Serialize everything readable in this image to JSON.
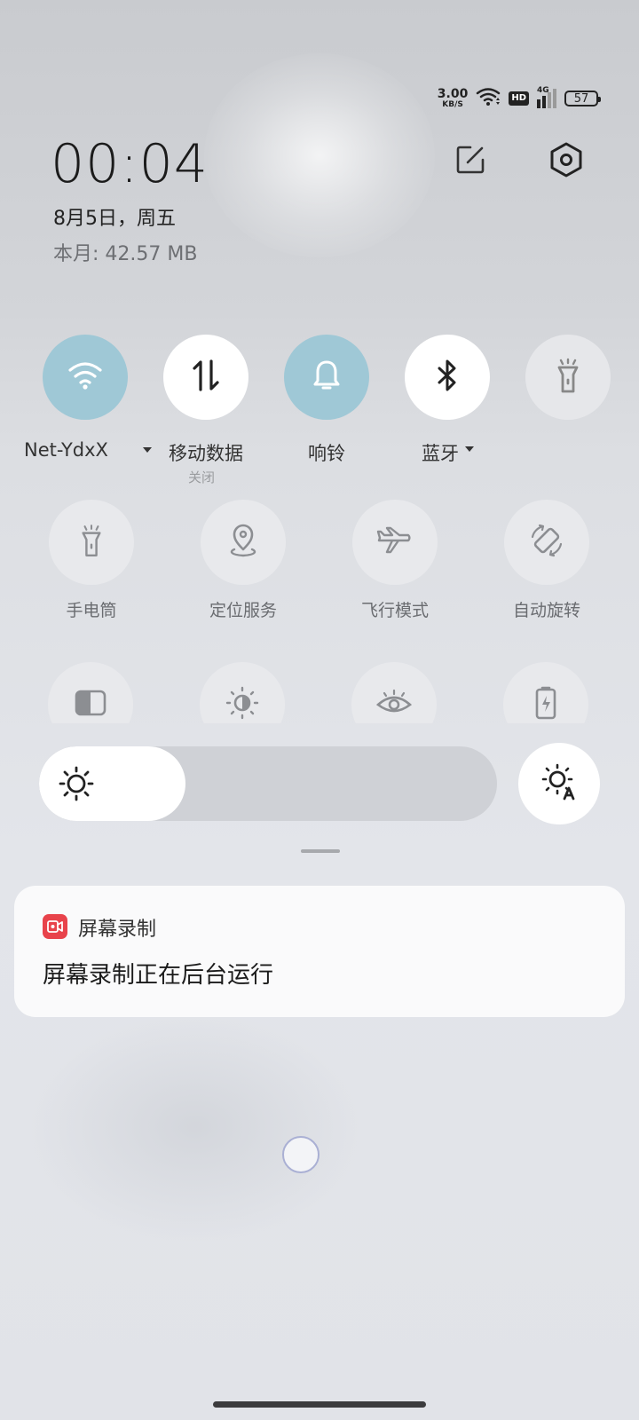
{
  "status_bar": {
    "speed_value": "3.00",
    "speed_unit": "KB/S",
    "hd": "HD",
    "network_type": "4G",
    "battery": "57"
  },
  "header": {
    "time": "00:04",
    "date": "8月5日，周五",
    "data_usage": "本月: 42.57 MB"
  },
  "big_toggles": [
    {
      "label": "Net-YdxX",
      "sub": "",
      "state": "on",
      "icon": "wifi-icon"
    },
    {
      "label": "移动数据",
      "sub": "关闭",
      "state": "off",
      "icon": "mobile-data-icon"
    },
    {
      "label": "响铃",
      "sub": "",
      "state": "on",
      "icon": "bell-icon"
    },
    {
      "label": "蓝牙",
      "sub": "",
      "state": "off",
      "icon": "bluetooth-icon"
    },
    {
      "label": "",
      "sub": "",
      "state": "off",
      "icon": "flashlight-icon"
    }
  ],
  "small_tiles": [
    {
      "label": "手电筒",
      "icon": "flashlight-icon"
    },
    {
      "label": "定位服务",
      "icon": "location-icon"
    },
    {
      "label": "飞行模式",
      "icon": "airplane-icon"
    },
    {
      "label": "自动旋转",
      "icon": "rotate-icon"
    }
  ],
  "small_tiles_row3": [
    {
      "icon": "split-screen-icon"
    },
    {
      "icon": "dark-mode-icon"
    },
    {
      "icon": "eye-comfort-icon"
    },
    {
      "icon": "battery-saver-icon"
    }
  ],
  "brightness": {
    "level": 0.32
  },
  "notification": {
    "app": "屏幕录制",
    "message": "屏幕录制正在后台运行",
    "app_color": "#e8434b"
  },
  "colors": {
    "toggle_on": "#9fc8d6"
  }
}
